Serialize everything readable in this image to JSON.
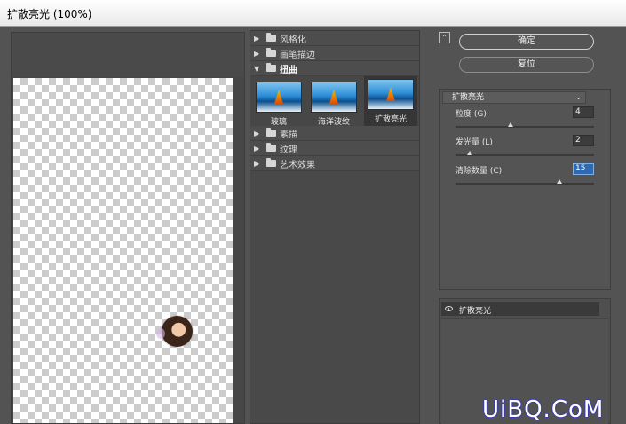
{
  "window": {
    "title": "扩散亮光 (100%)"
  },
  "categories": [
    {
      "label": "风格化",
      "open": false
    },
    {
      "label": "画笔描边",
      "open": false
    },
    {
      "label": "扭曲",
      "open": true
    },
    {
      "label": "素描",
      "open": false
    },
    {
      "label": "纹理",
      "open": false
    },
    {
      "label": "艺术效果",
      "open": false
    }
  ],
  "thumbs": [
    {
      "label": "玻璃"
    },
    {
      "label": "海洋波纹"
    },
    {
      "label": "扩散亮光",
      "selected": true
    }
  ],
  "buttons": {
    "ok": "确定",
    "reset": "复位",
    "toggle": "⌃"
  },
  "filter_select": {
    "value": "扩散亮光"
  },
  "params": [
    {
      "label": "粒度 (G)",
      "value": "4",
      "fraction": 0.4
    },
    {
      "label": "发光量 (L)",
      "value": "2",
      "fraction": 0.1
    },
    {
      "label": "清除数量 (C)",
      "value": "15",
      "fraction": 0.75,
      "focused": true
    }
  ],
  "layer": {
    "name": "扩散亮光"
  },
  "watermark": "UiBQ.CoM"
}
